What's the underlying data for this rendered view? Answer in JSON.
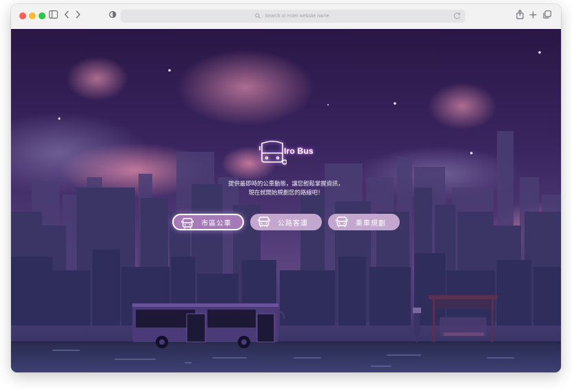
{
  "browser": {
    "address_placeholder": "Search or enter website name"
  },
  "app": {
    "logo_text": "Iro Bus",
    "tagline_line1": "提供最即時的公車動態，讓您輕鬆掌握資訊，",
    "tagline_line2": "現在就開始規劃您的路線吧！"
  },
  "nav": {
    "buttons": [
      {
        "label": "市區公車",
        "icon": "bus-icon",
        "active": true
      },
      {
        "label": "公路客運",
        "icon": "bus-icon",
        "active": false
      },
      {
        "label": "乘車規劃",
        "icon": "bus-icon",
        "active": false
      }
    ]
  },
  "colors": {
    "sky_top": "#2a1745",
    "sky_bottom": "#6a4f86",
    "button_fill": "#c4a7cf",
    "button_active": "#a67ab7",
    "accent_glow": "#d98cff"
  }
}
